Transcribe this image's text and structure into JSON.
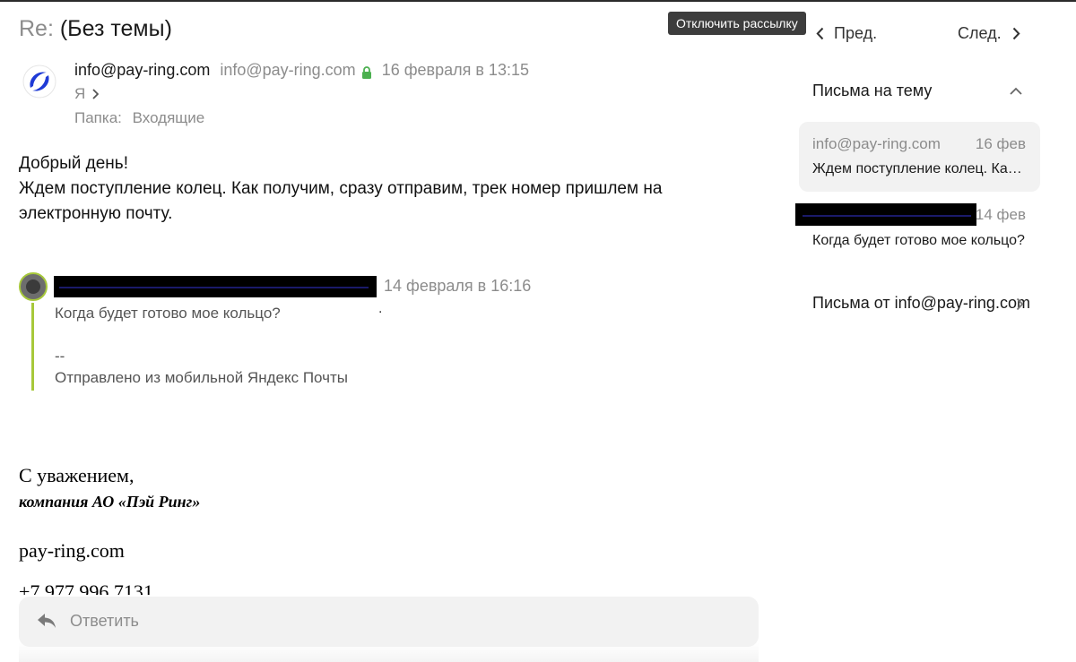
{
  "message": {
    "subject_prefix": "Re:",
    "subject": "(Без темы)",
    "sender_name": "info@pay-ring.com",
    "sender_email": "info@pay-ring.com",
    "date": "16 февраля в 13:15",
    "recipient": "Я",
    "folder_label": "Папка:",
    "folder_name": "Входящие",
    "body_lines": [
      "Добрый день!",
      "Ждем поступление колец. Как получим, сразу отправим, трек номер пришлем на",
      "электронную почту."
    ]
  },
  "quote": {
    "date": "14 февраля в 16:16",
    "text": "Когда будет готово мое кольцо?",
    "dot": ".",
    "separator": "--",
    "signature": "Отправлено из мобильной Яндекс Почты"
  },
  "signature": {
    "regards": "С уважением,",
    "company": "компания АО «Пэй Ринг»",
    "website": "pay-ring.com",
    "phone": "+7 977 996 7131"
  },
  "reply": {
    "label": "Ответить"
  },
  "tooltip": {
    "text": "Отключить рассылку"
  },
  "navigation": {
    "prev": "Пред.",
    "next": "След."
  },
  "thread": {
    "title": "Письма на тему",
    "items": [
      {
        "from": "info@pay-ring.com",
        "date": "16 фев",
        "subject": "Ждем поступление колец. Как получим, сразу отправим"
      },
      {
        "from": "",
        "date": "14 фев",
        "subject": "Когда будет готово мое кольцо?"
      }
    ]
  },
  "from_link": {
    "label": "Письма от info@pay-ring.com"
  },
  "colors": {
    "accent_green": "#a7c83a",
    "secure_lock": "#4cb050",
    "logo_blue": "#1f3bd6",
    "muted": "#8c8c8c"
  },
  "icons": [
    "avatar-logo",
    "lock-icon",
    "chevron-right-icon",
    "chevron-left-icon",
    "chevron-up-icon",
    "reply-icon"
  ]
}
